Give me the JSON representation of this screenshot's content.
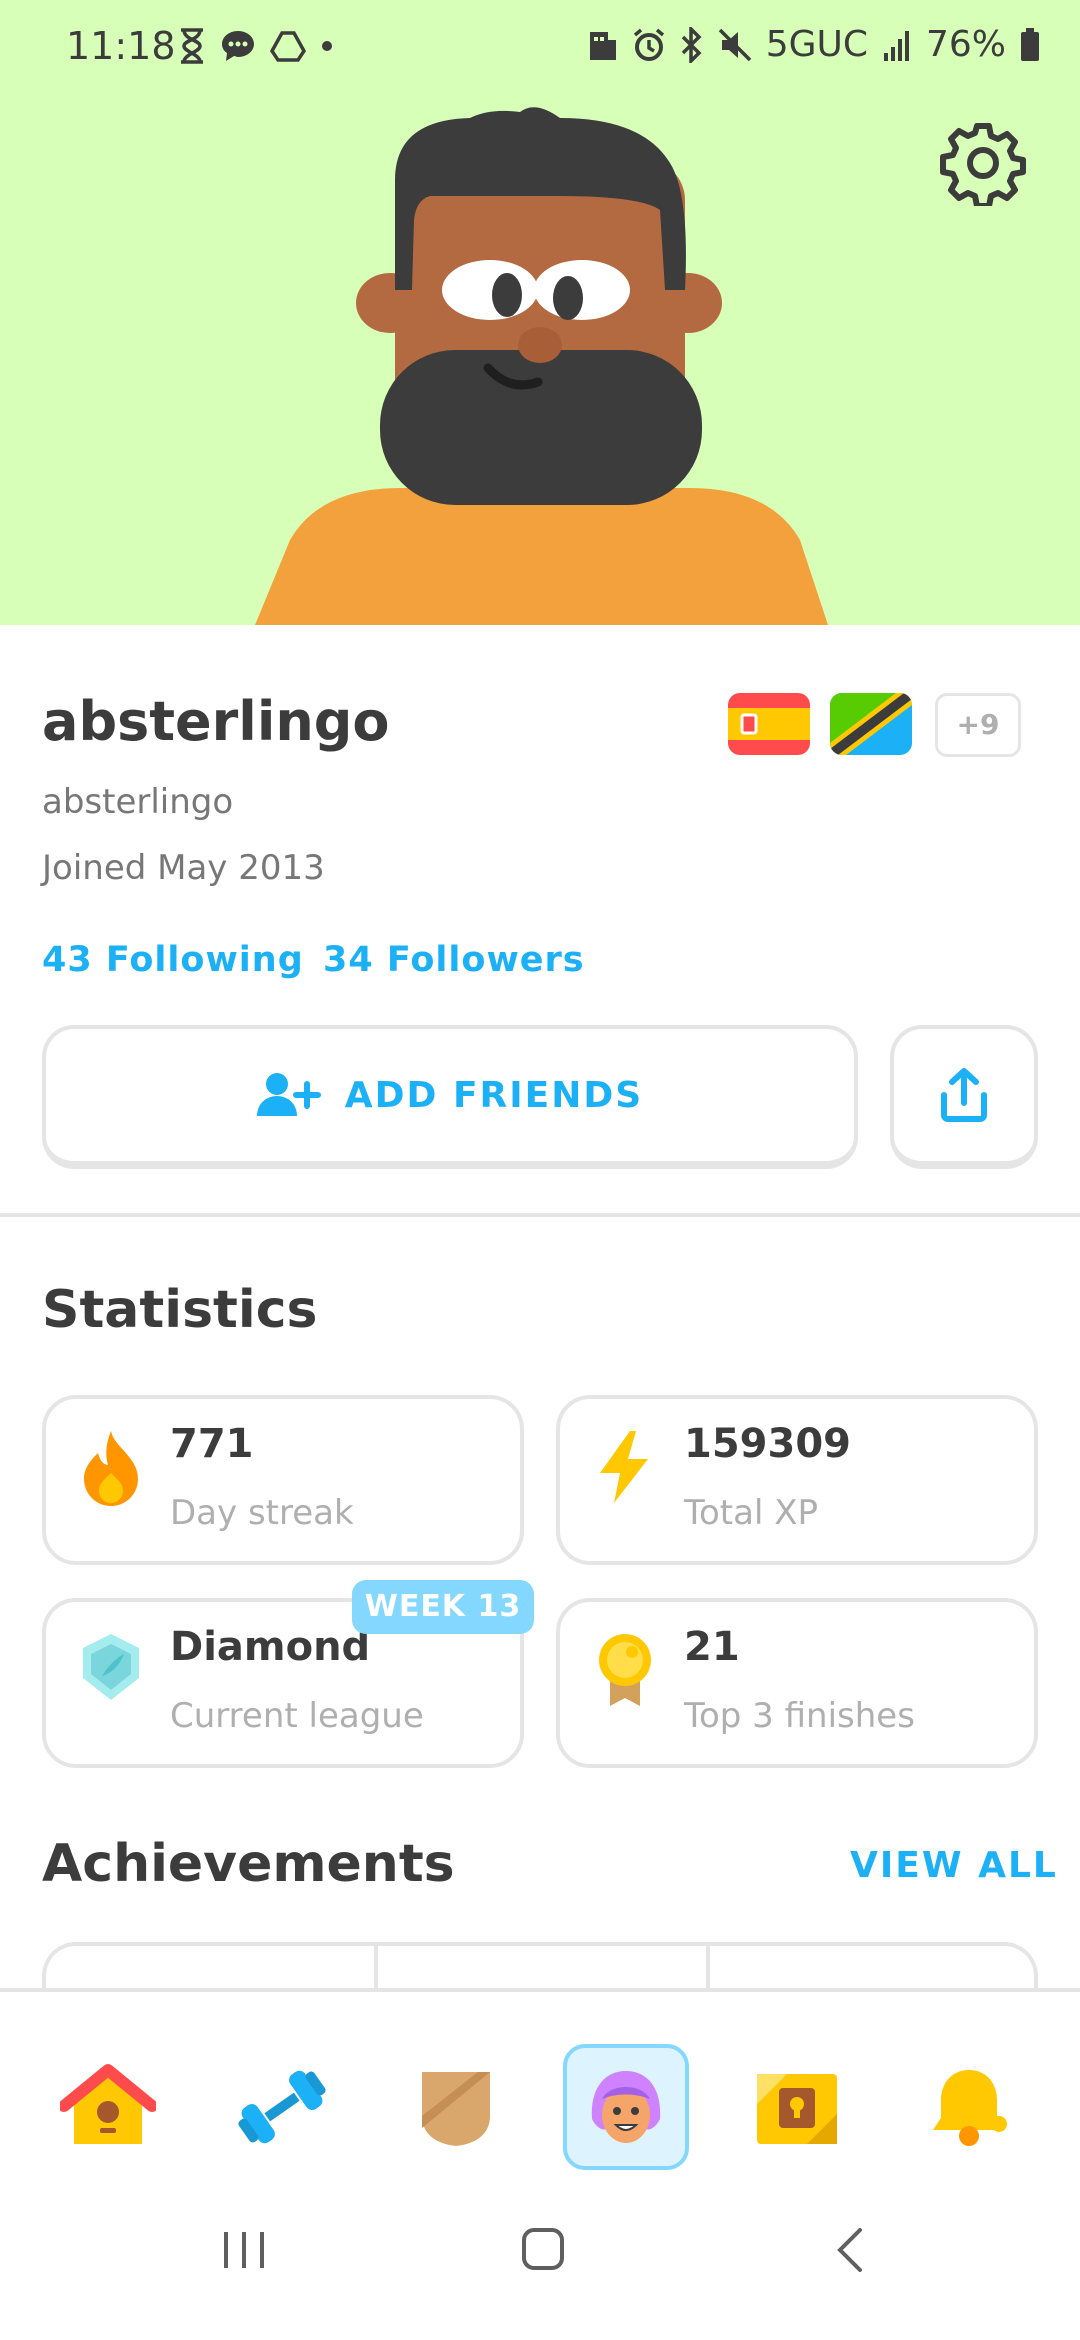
{
  "status_bar": {
    "time": "11:18",
    "network": "5GUC",
    "battery": "76%",
    "left_icons": [
      "hourglass-icon",
      "chat-icon",
      "drive-icon",
      "dot-icon"
    ],
    "right_icons": [
      "building-icon",
      "alarm-icon",
      "bluetooth-icon",
      "mute-icon",
      "signal-icon",
      "battery-icon"
    ]
  },
  "profile": {
    "display_name": "absterlingo",
    "username": "absterlingo",
    "joined": "Joined May 2013",
    "following": "43 Following",
    "followers": "34 Followers",
    "extra_courses": "+9",
    "flags": [
      "spain-flag",
      "tanzania-flag"
    ]
  },
  "actions": {
    "add_friends_label": "ADD FRIENDS"
  },
  "statistics": {
    "title": "Statistics",
    "items": [
      {
        "value": "771",
        "label": "Day streak",
        "icon": "flame-icon"
      },
      {
        "value": "159309",
        "label": "Total XP",
        "icon": "lightning-icon"
      },
      {
        "value": "Diamond",
        "label": "Current league",
        "icon": "diamond-league-icon",
        "badge": "WEEK 13"
      },
      {
        "value": "21",
        "label": "Top 3 finishes",
        "icon": "medal-icon"
      }
    ]
  },
  "achievements": {
    "title": "Achievements",
    "view_all": "VIEW ALL"
  },
  "nav": {
    "items": [
      "home-icon",
      "practice-icon",
      "leagues-icon",
      "profile-icon",
      "shop-icon",
      "notifications-icon"
    ],
    "active": "profile-icon"
  },
  "colors": {
    "hero_bg": "#d7ffb8",
    "accent_blue": "#1cb0f6",
    "border": "#e5e5e5",
    "badge_blue": "#84d8ff"
  }
}
